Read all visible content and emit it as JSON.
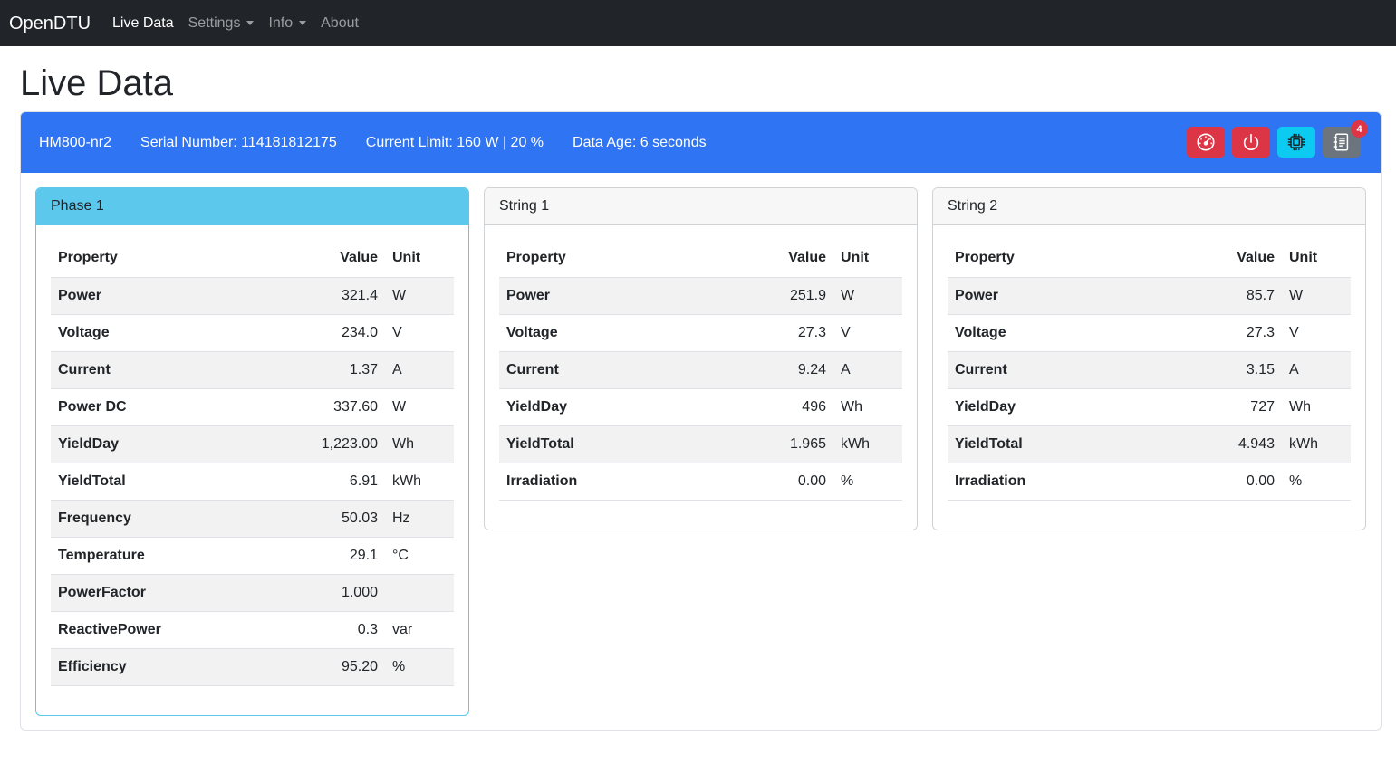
{
  "nav": {
    "brand": "OpenDTU",
    "items": [
      {
        "label": "Live Data"
      },
      {
        "label": "Settings"
      },
      {
        "label": "Info"
      },
      {
        "label": "About"
      }
    ]
  },
  "page": {
    "title": "Live Data"
  },
  "inverter": {
    "name": "HM800-nr2",
    "serial": "Serial Number: 114181812175",
    "limit": "Current Limit: 160 W | 20 %",
    "age": "Data Age: 6 seconds",
    "tools": [
      {
        "icon": "speedometer-icon",
        "color": "#dc3545"
      },
      {
        "icon": "power-icon",
        "color": "#dc3545"
      },
      {
        "icon": "cpu-icon",
        "color": "#0dcaf0"
      },
      {
        "icon": "journal-icon",
        "color": "#6c757d",
        "badge": "4"
      }
    ]
  },
  "table_headers": {
    "property": "Property",
    "value": "Value",
    "unit": "Unit"
  },
  "cards": [
    {
      "title": "Phase 1",
      "rows": [
        {
          "property": "Power",
          "value": "321.4",
          "unit": "W"
        },
        {
          "property": "Voltage",
          "value": "234.0",
          "unit": "V"
        },
        {
          "property": "Current",
          "value": "1.37",
          "unit": "A"
        },
        {
          "property": "Power DC",
          "value": "337.60",
          "unit": "W"
        },
        {
          "property": "YieldDay",
          "value": "1,223.00",
          "unit": "Wh"
        },
        {
          "property": "YieldTotal",
          "value": "6.91",
          "unit": "kWh"
        },
        {
          "property": "Frequency",
          "value": "50.03",
          "unit": "Hz"
        },
        {
          "property": "Temperature",
          "value": "29.1",
          "unit": "°C"
        },
        {
          "property": "PowerFactor",
          "value": "1.000",
          "unit": ""
        },
        {
          "property": "ReactivePower",
          "value": "0.3",
          "unit": "var"
        },
        {
          "property": "Efficiency",
          "value": "95.20",
          "unit": "%"
        }
      ]
    },
    {
      "title": "String 1",
      "rows": [
        {
          "property": "Power",
          "value": "251.9",
          "unit": "W"
        },
        {
          "property": "Voltage",
          "value": "27.3",
          "unit": "V"
        },
        {
          "property": "Current",
          "value": "9.24",
          "unit": "A"
        },
        {
          "property": "YieldDay",
          "value": "496",
          "unit": "Wh"
        },
        {
          "property": "YieldTotal",
          "value": "1.965",
          "unit": "kWh"
        },
        {
          "property": "Irradiation",
          "value": "0.00",
          "unit": "%"
        }
      ]
    },
    {
      "title": "String 2",
      "rows": [
        {
          "property": "Power",
          "value": "85.7",
          "unit": "W"
        },
        {
          "property": "Voltage",
          "value": "27.3",
          "unit": "V"
        },
        {
          "property": "Current",
          "value": "3.15",
          "unit": "A"
        },
        {
          "property": "YieldDay",
          "value": "727",
          "unit": "Wh"
        },
        {
          "property": "YieldTotal",
          "value": "4.943",
          "unit": "kWh"
        },
        {
          "property": "Irradiation",
          "value": "0.00",
          "unit": "%"
        }
      ]
    }
  ]
}
